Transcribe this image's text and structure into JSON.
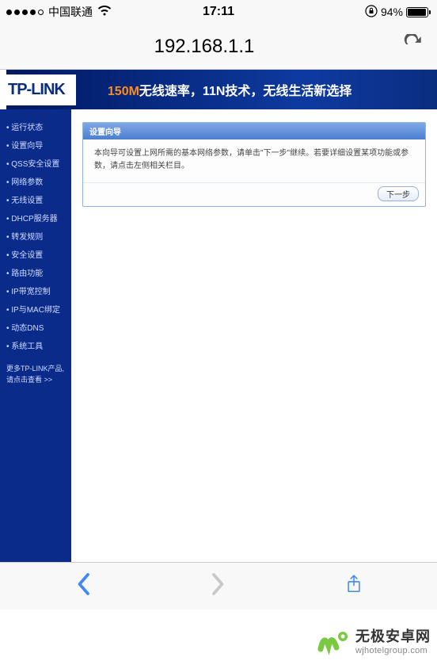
{
  "status": {
    "carrier": "中国联通",
    "time": "17:11",
    "battery_pct": "94%"
  },
  "browser": {
    "url": "192.168.1.1"
  },
  "router": {
    "logo": "TP-LINK",
    "banner_orange": "150M",
    "banner_rest": "无线速率，11N技术，无线生活新选择",
    "menu": [
      "运行状态",
      "设置向导",
      "QSS安全设置",
      "网络参数",
      "无线设置",
      "DHCP服务器",
      "转发规则",
      "安全设置",
      "路由功能",
      "IP带宽控制",
      "IP与MAC绑定",
      "动态DNS",
      "系统工具"
    ],
    "menu_footer_line1": "更多TP-LINK产品,",
    "menu_footer_line2": "请点击查看 >>",
    "wizard": {
      "title": "设置向导",
      "body": "本向导可设置上网所需的基本网络参数，请单击\"下一步\"继续。若要详细设置某项功能或参数，请点击左侧相关栏目。",
      "next": "下一步"
    }
  },
  "watermark": {
    "cn": "无极安卓网",
    "en": "wjhotelgroup.com"
  }
}
